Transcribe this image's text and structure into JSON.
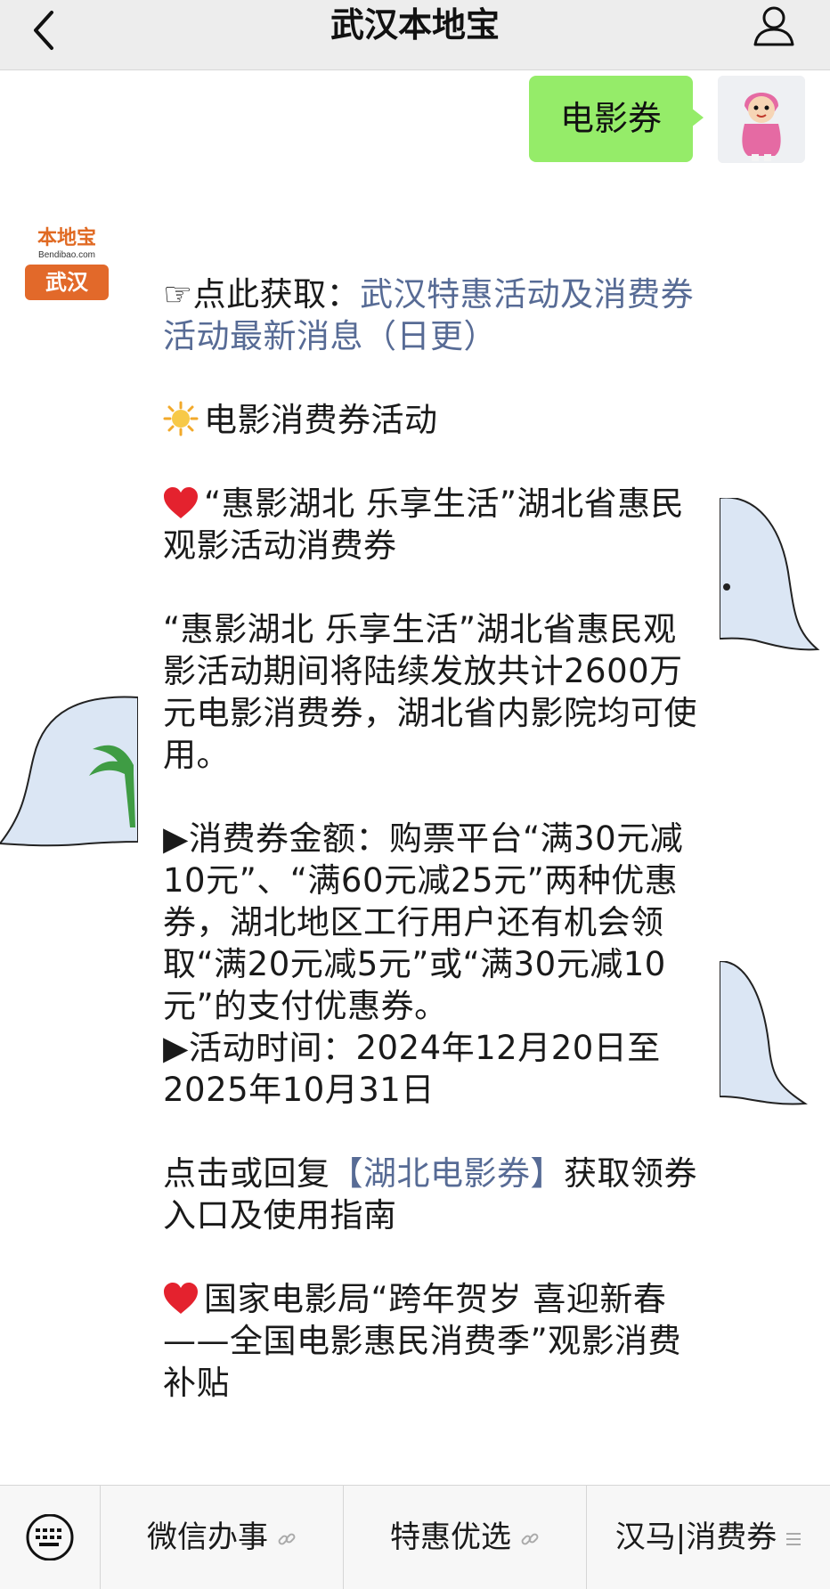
{
  "header": {
    "title": "武汉本地宝",
    "back_icon": "chevron-left-icon",
    "profile_icon": "person-icon"
  },
  "chat": {
    "outgoing_message": "电影券",
    "account_avatar": {
      "logo_text": "本地宝",
      "logo_domain": "Bendibao.com",
      "city": "武汉"
    },
    "reply": {
      "link_prefix": "☞点此获取：",
      "link_text": "武汉特惠活动及消费券活动最新消息（日更）",
      "section_title": "电影消费券活动",
      "item1_title": "“惠影湖北 乐享生活”湖北省惠民观影活动消费券",
      "item1_body": "“惠影湖北 乐享生活”湖北省惠民观影活动期间将陆续发放共计2600万元电影消费券，湖北省内影院均可使用。",
      "amount_text": "▶消费券金额：购票平台“满30元减10元”、“满60元减25元”两种优惠券，湖北地区工行用户还有机会领取“满20元减5元”或“满30元减10元”的支付优惠券。",
      "time_text": "▶活动时间：2024年12月20日至2025年10月31日",
      "cta_prefix": "点击或回复",
      "cta_link": "【湖北电影券】",
      "cta_suffix": "获取领券入口及使用指南",
      "item2_title": "国家电影局“跨年贺岁 喜迎新春——全国电影惠民消费季”观影消费补贴"
    }
  },
  "bottom_menu": {
    "keyboard_icon": "keyboard-icon",
    "items": [
      {
        "label": "微信办事",
        "icon": "link-icon"
      },
      {
        "label": "特惠优选",
        "icon": "link-icon"
      },
      {
        "label": "汉马|消费券",
        "icon": "menu-icon"
      }
    ]
  },
  "colors": {
    "link": "#576b95",
    "outgoing_bubble": "#95ec69",
    "topbar": "#ededed",
    "brand_orange": "#e2692a"
  }
}
